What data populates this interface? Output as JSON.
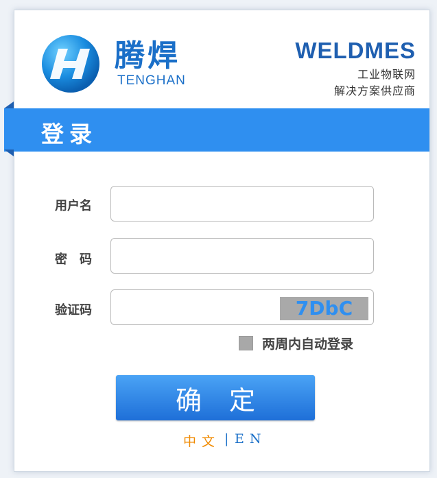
{
  "brand": {
    "name_cn": "腾焊",
    "name_en": "TENGHAN",
    "product": "WELDMES",
    "tagline_1": "工业物联网",
    "tagline_2": "解决方案供应商"
  },
  "login": {
    "title": "登录",
    "username_label": "用户名",
    "password_label": "密　码",
    "captcha_label": "验证码",
    "username_value": "",
    "password_value": "",
    "captcha_value": "",
    "captcha_code": "7DbC",
    "remember_label": "两周内自动登录",
    "submit_label": "确定"
  },
  "language": {
    "zh": "中文",
    "separator": "|",
    "en": "EN"
  },
  "colors": {
    "accent": "#2f8ff0",
    "brand_blue": "#1a6fc8",
    "lang_active": "#f08a00"
  }
}
